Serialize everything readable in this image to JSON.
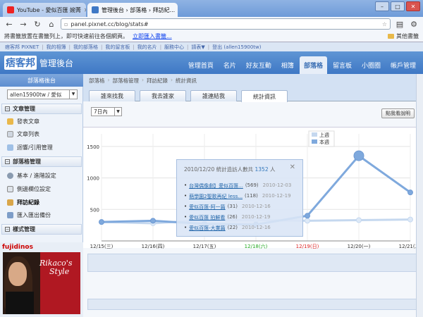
{
  "browser": {
    "tabs": [
      {
        "label": "YouTube - 愛似百匯 婉菁",
        "icon": "youtube-icon"
      },
      {
        "label": "管理後台 › 部落格 › 拜訪紀...",
        "icon": "pixnet-icon"
      }
    ],
    "url": "panel.pixnet.cc/blog/stats#",
    "bookmark_notice": "將書籤放置在書籤列上，即可快速前往各個網頁。",
    "bookmark_import": "立即匯入書籤...",
    "other_bookmarks": "其他書籤"
  },
  "sitebar": [
    "痞客邦 PIXNET",
    "我的相簿",
    "我的部落格",
    "我的留言板",
    "我的名片",
    "服務中心",
    "請表▼",
    "登出 (allen15900tw)"
  ],
  "header": {
    "logo": "痞客邦",
    "subtitle": "管理後台",
    "nav": [
      "管理首頁",
      "名片",
      "好友互動",
      "相簿",
      "部落格",
      "留言板",
      "小圈圈",
      "帳戶管理"
    ],
    "active_nav": "部落格"
  },
  "sidebar": {
    "title": "部落格後台",
    "blog_select": "allen15900tw / 愛似",
    "sections": [
      {
        "label": "文章管理",
        "items": [
          "發表文章",
          "文章列表",
          "迴響/引用管理"
        ]
      },
      {
        "label": "部落格管理",
        "items": [
          "基本 / 進階設定",
          "側邊欄位設定",
          "拜訪紀錄",
          "匯入匯出備份"
        ]
      },
      {
        "label": "樣式管理",
        "items": []
      }
    ],
    "active_item": "拜訪紀錄"
  },
  "ad": {
    "brand": "fujidinos",
    "text_line1": "Rikaco's",
    "text_line2": "Style"
  },
  "breadcrumb": [
    "部落格",
    "部落格管理",
    "拜訪紀錄",
    "統計資訊"
  ],
  "subtabs": [
    "誰來找我",
    "我去誰家",
    "誰連結我",
    "統計資訊"
  ],
  "active_subtab": "統計資訊",
  "range_select": "7日內",
  "help_button": "點我看說明",
  "popup": {
    "title_prefix": "2010/12/20 統計造訪人數共",
    "count": "1352",
    "title_suffix": "人",
    "rows": [
      {
        "title": "台灣偶像劇】愛似百匯...",
        "count": "(569)",
        "date": "2010-12-03"
      },
      {
        "title": "萌學園2聖歌再紀 less...",
        "count": "(118)",
        "date": "2010-12-19"
      },
      {
        "title": "愛似百匯-阿一篇",
        "count": "(31)",
        "date": "2010-12-16"
      },
      {
        "title": "愛似百匯 拍鮮看",
        "count": "(26)",
        "date": "2010-12-19"
      },
      {
        "title": "愛似百匯-大業篇",
        "count": "(22)",
        "date": "2010-12-16"
      }
    ]
  },
  "chart_data": {
    "type": "line",
    "categories": [
      "12/15(三)",
      "12/16(四)",
      "12/17(五)",
      "12/18(六)",
      "12/19(日)",
      "12/20(一)",
      "12/21(二)"
    ],
    "category_colors": [
      "#333333",
      "#333333",
      "#333333",
      "#22aa22",
      "#dd2222",
      "#333333",
      "#333333"
    ],
    "ylim": [
      0,
      1700
    ],
    "yticks": [
      "500",
      "1000",
      "1500"
    ],
    "legend": [
      "上週",
      "本週"
    ],
    "legend_position": "top-right",
    "grid": true,
    "series": [
      {
        "name": "上週",
        "values": [
          300,
          280,
          330,
          330,
          320,
          330,
          340
        ],
        "color": "#c5d8ef"
      },
      {
        "name": "本週",
        "values": [
          300,
          320,
          270,
          260,
          400,
          1352,
          770
        ],
        "color": "#7fa9dd"
      }
    ]
  }
}
